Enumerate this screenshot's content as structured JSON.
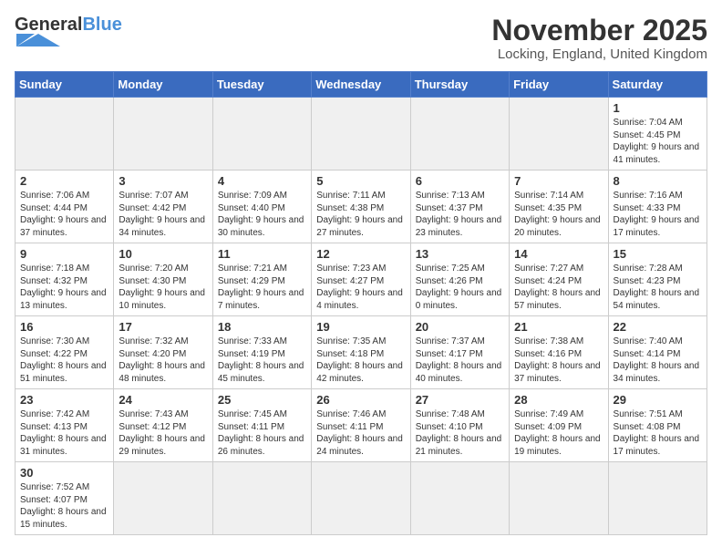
{
  "header": {
    "logo_general": "General",
    "logo_blue": "Blue",
    "title": "November 2025",
    "location": "Locking, England, United Kingdom"
  },
  "days_of_week": [
    "Sunday",
    "Monday",
    "Tuesday",
    "Wednesday",
    "Thursday",
    "Friday",
    "Saturday"
  ],
  "weeks": [
    [
      {
        "day": "",
        "info": ""
      },
      {
        "day": "",
        "info": ""
      },
      {
        "day": "",
        "info": ""
      },
      {
        "day": "",
        "info": ""
      },
      {
        "day": "",
        "info": ""
      },
      {
        "day": "",
        "info": ""
      },
      {
        "day": "1",
        "info": "Sunrise: 7:04 AM\nSunset: 4:45 PM\nDaylight: 9 hours and 41 minutes."
      }
    ],
    [
      {
        "day": "2",
        "info": "Sunrise: 7:06 AM\nSunset: 4:44 PM\nDaylight: 9 hours and 37 minutes."
      },
      {
        "day": "3",
        "info": "Sunrise: 7:07 AM\nSunset: 4:42 PM\nDaylight: 9 hours and 34 minutes."
      },
      {
        "day": "4",
        "info": "Sunrise: 7:09 AM\nSunset: 4:40 PM\nDaylight: 9 hours and 30 minutes."
      },
      {
        "day": "5",
        "info": "Sunrise: 7:11 AM\nSunset: 4:38 PM\nDaylight: 9 hours and 27 minutes."
      },
      {
        "day": "6",
        "info": "Sunrise: 7:13 AM\nSunset: 4:37 PM\nDaylight: 9 hours and 23 minutes."
      },
      {
        "day": "7",
        "info": "Sunrise: 7:14 AM\nSunset: 4:35 PM\nDaylight: 9 hours and 20 minutes."
      },
      {
        "day": "8",
        "info": "Sunrise: 7:16 AM\nSunset: 4:33 PM\nDaylight: 9 hours and 17 minutes."
      }
    ],
    [
      {
        "day": "9",
        "info": "Sunrise: 7:18 AM\nSunset: 4:32 PM\nDaylight: 9 hours and 13 minutes."
      },
      {
        "day": "10",
        "info": "Sunrise: 7:20 AM\nSunset: 4:30 PM\nDaylight: 9 hours and 10 minutes."
      },
      {
        "day": "11",
        "info": "Sunrise: 7:21 AM\nSunset: 4:29 PM\nDaylight: 9 hours and 7 minutes."
      },
      {
        "day": "12",
        "info": "Sunrise: 7:23 AM\nSunset: 4:27 PM\nDaylight: 9 hours and 4 minutes."
      },
      {
        "day": "13",
        "info": "Sunrise: 7:25 AM\nSunset: 4:26 PM\nDaylight: 9 hours and 0 minutes."
      },
      {
        "day": "14",
        "info": "Sunrise: 7:27 AM\nSunset: 4:24 PM\nDaylight: 8 hours and 57 minutes."
      },
      {
        "day": "15",
        "info": "Sunrise: 7:28 AM\nSunset: 4:23 PM\nDaylight: 8 hours and 54 minutes."
      }
    ],
    [
      {
        "day": "16",
        "info": "Sunrise: 7:30 AM\nSunset: 4:22 PM\nDaylight: 8 hours and 51 minutes."
      },
      {
        "day": "17",
        "info": "Sunrise: 7:32 AM\nSunset: 4:20 PM\nDaylight: 8 hours and 48 minutes."
      },
      {
        "day": "18",
        "info": "Sunrise: 7:33 AM\nSunset: 4:19 PM\nDaylight: 8 hours and 45 minutes."
      },
      {
        "day": "19",
        "info": "Sunrise: 7:35 AM\nSunset: 4:18 PM\nDaylight: 8 hours and 42 minutes."
      },
      {
        "day": "20",
        "info": "Sunrise: 7:37 AM\nSunset: 4:17 PM\nDaylight: 8 hours and 40 minutes."
      },
      {
        "day": "21",
        "info": "Sunrise: 7:38 AM\nSunset: 4:16 PM\nDaylight: 8 hours and 37 minutes."
      },
      {
        "day": "22",
        "info": "Sunrise: 7:40 AM\nSunset: 4:14 PM\nDaylight: 8 hours and 34 minutes."
      }
    ],
    [
      {
        "day": "23",
        "info": "Sunrise: 7:42 AM\nSunset: 4:13 PM\nDaylight: 8 hours and 31 minutes."
      },
      {
        "day": "24",
        "info": "Sunrise: 7:43 AM\nSunset: 4:12 PM\nDaylight: 8 hours and 29 minutes."
      },
      {
        "day": "25",
        "info": "Sunrise: 7:45 AM\nSunset: 4:11 PM\nDaylight: 8 hours and 26 minutes."
      },
      {
        "day": "26",
        "info": "Sunrise: 7:46 AM\nSunset: 4:11 PM\nDaylight: 8 hours and 24 minutes."
      },
      {
        "day": "27",
        "info": "Sunrise: 7:48 AM\nSunset: 4:10 PM\nDaylight: 8 hours and 21 minutes."
      },
      {
        "day": "28",
        "info": "Sunrise: 7:49 AM\nSunset: 4:09 PM\nDaylight: 8 hours and 19 minutes."
      },
      {
        "day": "29",
        "info": "Sunrise: 7:51 AM\nSunset: 4:08 PM\nDaylight: 8 hours and 17 minutes."
      }
    ],
    [
      {
        "day": "30",
        "info": "Sunrise: 7:52 AM\nSunset: 4:07 PM\nDaylight: 8 hours and 15 minutes."
      },
      {
        "day": "",
        "info": ""
      },
      {
        "day": "",
        "info": ""
      },
      {
        "day": "",
        "info": ""
      },
      {
        "day": "",
        "info": ""
      },
      {
        "day": "",
        "info": ""
      },
      {
        "day": "",
        "info": ""
      }
    ]
  ]
}
